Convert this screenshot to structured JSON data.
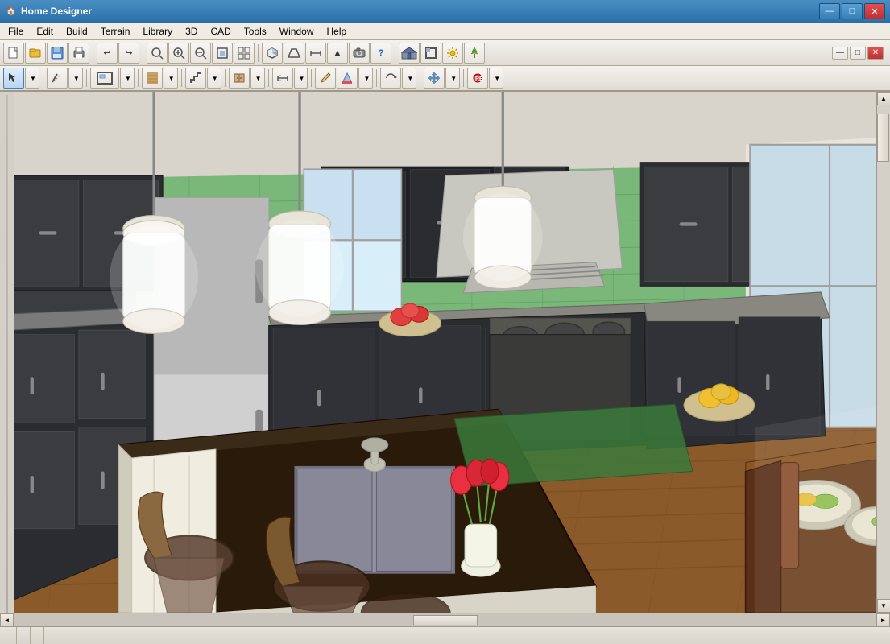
{
  "window": {
    "title": "Home Designer",
    "icon": "🏠"
  },
  "title_bar_controls": {
    "minimize": "—",
    "maximize": "□",
    "close": "✕"
  },
  "menu": {
    "items": [
      "File",
      "Edit",
      "Build",
      "Terrain",
      "Library",
      "3D",
      "CAD",
      "Tools",
      "Window",
      "Help"
    ]
  },
  "toolbar1": {
    "buttons": [
      {
        "name": "new",
        "icon": "📄"
      },
      {
        "name": "open",
        "icon": "📂"
      },
      {
        "name": "save",
        "icon": "💾"
      },
      {
        "name": "print",
        "icon": "🖨"
      },
      {
        "name": "undo",
        "icon": "↩"
      },
      {
        "name": "redo",
        "icon": "↪"
      },
      {
        "name": "zoom-out-small",
        "icon": "🔍"
      },
      {
        "name": "zoom-in",
        "icon": "⊕"
      },
      {
        "name": "zoom-out",
        "icon": "⊖"
      },
      {
        "name": "fit-window",
        "icon": "⊡"
      },
      {
        "name": "view-3d",
        "icon": "⬛"
      },
      {
        "name": "measure",
        "icon": "📏"
      },
      {
        "name": "up-arrow",
        "icon": "↑"
      },
      {
        "name": "camera",
        "icon": "📷"
      },
      {
        "name": "question",
        "icon": "?"
      },
      {
        "name": "house1",
        "icon": "🏠"
      },
      {
        "name": "house2",
        "icon": "⌂"
      },
      {
        "name": "sun",
        "icon": "☀"
      },
      {
        "name": "house3",
        "icon": "🏡"
      }
    ]
  },
  "toolbar2": {
    "buttons": [
      {
        "name": "select",
        "icon": "↖"
      },
      {
        "name": "draw-wall",
        "icon": "⌐"
      },
      {
        "name": "room",
        "icon": "▭"
      },
      {
        "name": "material",
        "icon": "▤"
      },
      {
        "name": "stairs",
        "icon": "⌇"
      },
      {
        "name": "cabinet",
        "icon": "▪"
      },
      {
        "name": "dimension",
        "icon": "↔"
      },
      {
        "name": "pencil",
        "icon": "✏"
      },
      {
        "name": "color",
        "icon": "🎨"
      },
      {
        "name": "rotate",
        "icon": "↺"
      },
      {
        "name": "move",
        "icon": "⤢"
      },
      {
        "name": "record",
        "icon": "⏺"
      }
    ]
  },
  "status_bar": {
    "sections": [
      "",
      "",
      ""
    ]
  },
  "scrollbar": {
    "up_arrow": "▲",
    "down_arrow": "▼",
    "left_arrow": "◄",
    "right_arrow": "►"
  }
}
